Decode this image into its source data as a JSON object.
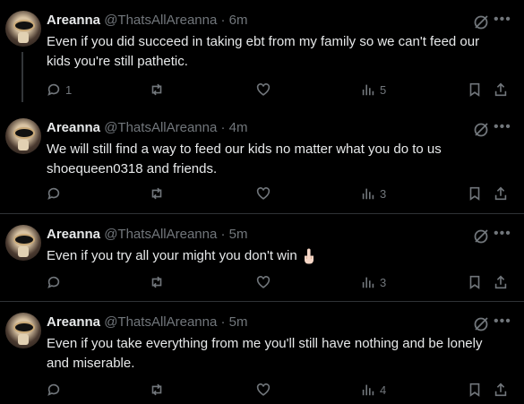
{
  "tweets": [
    {
      "name": "Areanna",
      "handle": "@ThatsAllAreanna",
      "time": "6m",
      "text": "Even if you did succeed in taking ebt from my family so we can't feed our kids you're still pathetic.",
      "replies": "1",
      "views": "5"
    },
    {
      "name": "Areanna",
      "handle": "@ThatsAllAreanna",
      "time": "4m",
      "text": "We will still find a way to feed our kids no matter what you do to us shoequeen0318 and friends.",
      "replies": "",
      "views": "3"
    },
    {
      "name": "Areanna",
      "handle": "@ThatsAllAreanna",
      "time": "5m",
      "text": "Even if you try all your might you don't win",
      "emoji": "middle-finger-emoji",
      "replies": "",
      "views": "3"
    },
    {
      "name": "Areanna",
      "handle": "@ThatsAllAreanna",
      "time": "5m",
      "text": "Even if you take everything from me you'll still have nothing and be lonely and miserable.",
      "replies": "",
      "views": "4"
    }
  ],
  "separator": " · ",
  "icons": {
    "reply": "reply-icon",
    "repost": "repost-icon",
    "like": "like-icon",
    "views": "views-icon",
    "bookmark": "bookmark-icon",
    "share": "share-icon",
    "grok": "grok-icon",
    "more": "more-icon"
  },
  "colors": {
    "background": "#000000",
    "text": "#e7e9ea",
    "muted": "#71767b",
    "divider": "#2f3336"
  }
}
